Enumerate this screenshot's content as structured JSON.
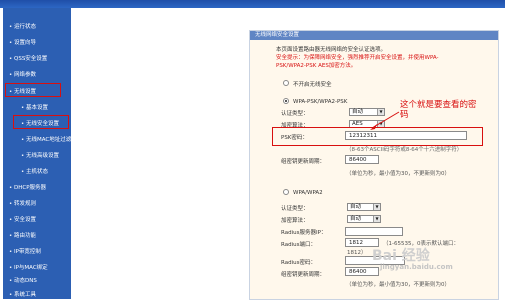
{
  "sidebar": {
    "items": [
      {
        "label": "• 运行状态"
      },
      {
        "label": "• 设置向导"
      },
      {
        "label": "• QSS安全设置"
      },
      {
        "label": "• 网络参数"
      },
      {
        "label": "• 无线设置"
      },
      {
        "label": "基本设置"
      },
      {
        "label": "无线安全设置"
      },
      {
        "label": "无线MAC地址过滤"
      },
      {
        "label": "无线高级设置"
      },
      {
        "label": "主机状态"
      },
      {
        "label": "• DHCP服务器"
      },
      {
        "label": "• 转发规则"
      },
      {
        "label": "• 安全设置"
      },
      {
        "label": "• 路由功能"
      },
      {
        "label": "• IP带宽控制"
      },
      {
        "label": "• IP与MAC绑定"
      },
      {
        "label": "• 动态DNS"
      },
      {
        "label": "• 系统工具"
      }
    ]
  },
  "panel": {
    "title": "无线网络安全设置",
    "intro": "本页面设置路由器无线网络的安全认证选项。",
    "warning_line1": "安全提示：为保障网络安全，强烈推荐开启安全设置，并使用WPA-",
    "warning_line2": "PSK/WPA2-PSK AES加密方法。",
    "option_none": "不开启无线安全",
    "option_psk": "WPA-PSK/WPA2-PSK",
    "auth_label": "认证类型：",
    "auth_value": "自动",
    "enc_label": "加密算法：",
    "enc_value": "AES",
    "psk_label": "PSK密码：",
    "psk_value": "12312311",
    "psk_hint": "（8-63个ASCII码字符或8-64个十六进制字符）",
    "period_label": "组密钥更新周期：",
    "period_value": "86400",
    "period_hint": "（单位为秒，最小值为30，不更新则为0）",
    "option_wpa": "WPA/WPA2",
    "auth2_label": "认证类型：",
    "auth2_value": "自动",
    "enc2_label": "加密算法：",
    "enc2_value": "自动",
    "radius_ip_label": "Radius服务器IP：",
    "radius_port_label": "Radius端口：",
    "radius_port_value": "1812",
    "radius_port_hint": "（1-65535，0表示默认端口：",
    "radius_port_hint2": "1812）",
    "radius_pwd_label": "Radius密码：",
    "period2_label": "组密钥更新周期：",
    "period2_value": "86400",
    "period2_hint": "（单位为秒，最小值为30，不更新则为0）"
  },
  "annotation": {
    "line1": "这个就是要查看的密",
    "line2": "码"
  },
  "watermark": "Bai 经验",
  "watermark_url": "jingyan.baidu.com"
}
